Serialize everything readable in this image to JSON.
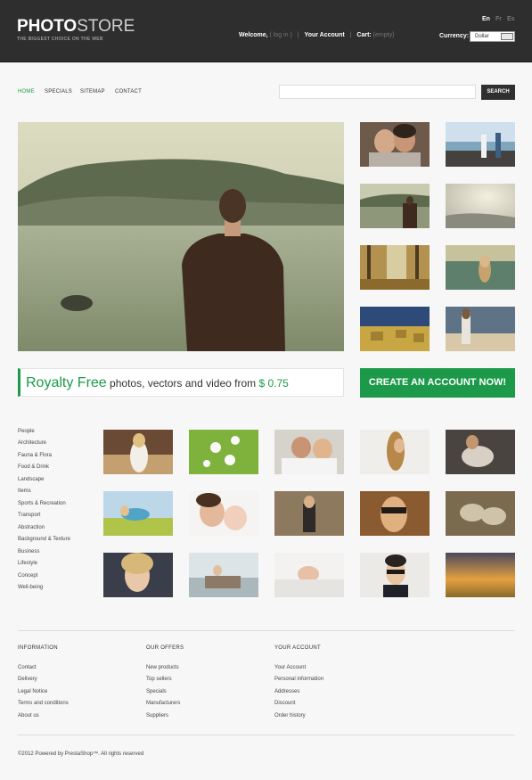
{
  "header": {
    "logo_bold": "PHOTO",
    "logo_light": "STORE",
    "tagline": "THE BIGGEST CHOICE ON THE WEB",
    "languages": [
      "En",
      "Fr",
      "Es"
    ],
    "welcome": "Welcome,",
    "login": "( log in )",
    "your_account": "Your Account",
    "cart_label": "Cart:",
    "cart_status": "(empty)",
    "currency_label": "Currency:",
    "currency_value": "Dollar"
  },
  "nav": {
    "items": [
      "HOME",
      "SPECIALS",
      "SITEMAP",
      "CONTACT"
    ],
    "active_color": "#1c9a4a"
  },
  "search": {
    "placeholder": "",
    "button_label": "SEARCH"
  },
  "banner": {
    "highlight": "Royalty Free",
    "text": "photos, vectors and video from",
    "price": "$ 0.75",
    "cta_label": "CREATE AN ACCOUNT NOW!"
  },
  "categories": [
    "People",
    "Architecture",
    "Fauna & Flora",
    "Food & Drink",
    "Landscape",
    "Items",
    "Sports & Recreation",
    "Transport",
    "Abstraction",
    "Background & Texture",
    "Business",
    "Lifestyle",
    "Concept",
    "Well-being"
  ],
  "footer": {
    "columns": [
      {
        "title": "INFORMATION",
        "links": [
          "Contact",
          "Delivery",
          "Legal Notice",
          "Terms and conditions",
          "About us"
        ]
      },
      {
        "title": "OUR OFFERS",
        "links": [
          "New products",
          "Top sellers",
          "Specials",
          "Manufacturers",
          "Suppliers"
        ]
      },
      {
        "title": "YOUR ACCOUNT",
        "links": [
          "Your Account",
          "Personal information",
          "Addresses",
          "Discount",
          "Order history"
        ]
      }
    ],
    "copyright": "©2012 Powered by PrestaShop™. All rights reserved"
  },
  "colors": {
    "accent": "#1c9a4a",
    "header_bg": "#2e2e2e",
    "page_bg": "#f7f7f7"
  }
}
